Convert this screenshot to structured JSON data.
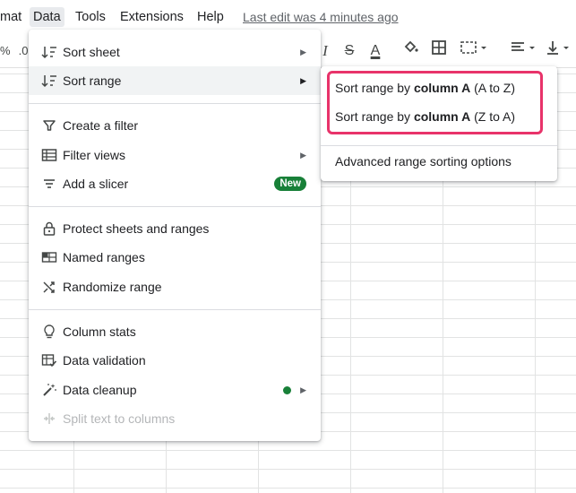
{
  "menubar": {
    "items": [
      {
        "label": "mat"
      },
      {
        "label": "Data"
      },
      {
        "label": "Tools"
      },
      {
        "label": "Extensions"
      },
      {
        "label": "Help"
      }
    ],
    "last_edit": "Last edit was 4 minutes ago"
  },
  "toolbar": {
    "percent": "%",
    "decimal": ".0",
    "strike": "S",
    "italic": "I",
    "textcolor": "A",
    "accent_underline": "#202124"
  },
  "data_menu": {
    "items": [
      {
        "label": "Sort sheet",
        "icon": "sort-icon",
        "submenu": true
      },
      {
        "label": "Sort range",
        "icon": "sort-icon",
        "submenu": true
      },
      {
        "label": "Create a filter",
        "icon": "filter-icon"
      },
      {
        "label": "Filter views",
        "icon": "filter-views-icon",
        "submenu": true
      },
      {
        "label": "Add a slicer",
        "icon": "slicer-icon",
        "badge": "New"
      },
      {
        "label": "Protect sheets and ranges",
        "icon": "lock-icon"
      },
      {
        "label": "Named ranges",
        "icon": "named-ranges-icon"
      },
      {
        "label": "Randomize range",
        "icon": "shuffle-icon"
      },
      {
        "label": "Column stats",
        "icon": "lightbulb-icon"
      },
      {
        "label": "Data validation",
        "icon": "data-validation-icon"
      },
      {
        "label": "Data cleanup",
        "icon": "magic-wand-icon",
        "submenu": true
      },
      {
        "label": "Split text to columns",
        "icon": "split-icon",
        "disabled": true
      }
    ]
  },
  "sort_submenu": {
    "items": [
      {
        "prefix": "Sort range by ",
        "bold": "column A",
        "suffix": " (A to Z)"
      },
      {
        "prefix": "Sort range by ",
        "bold": "column A",
        "suffix": " (Z to A)"
      },
      {
        "prefix": "Advanced range sorting options",
        "bold": "",
        "suffix": ""
      }
    ]
  },
  "colors": {
    "highlight_border": "#e8336a",
    "badge_green": "#188038"
  }
}
